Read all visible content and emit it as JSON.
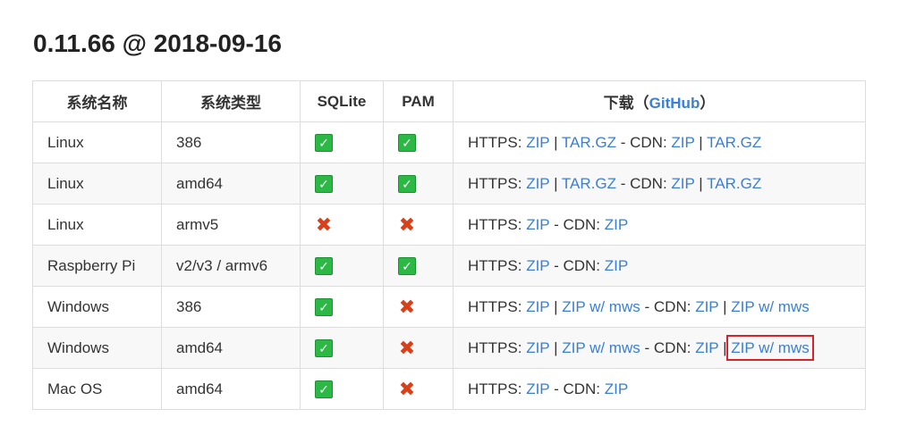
{
  "release": {
    "title": "0.11.66 @ 2018-09-16"
  },
  "table": {
    "headers": {
      "system_name": "系统名称",
      "system_type": "系统类型",
      "sqlite": "SQLite",
      "pam": "PAM",
      "download_prefix": "下载（",
      "github": "GitHub",
      "download_suffix": "）"
    },
    "labels": {
      "https": "HTTPS:",
      "cdn": "CDN:",
      "pipe": "|",
      "dash": "-"
    },
    "rows": [
      {
        "name": "Linux",
        "type": "386",
        "sqlite": "check-icon",
        "pam": "check-icon",
        "https": [
          "ZIP",
          "TAR.GZ"
        ],
        "cdn": [
          "ZIP",
          "TAR.GZ"
        ]
      },
      {
        "name": "Linux",
        "type": "amd64",
        "sqlite": "check-icon",
        "pam": "check-icon",
        "https": [
          "ZIP",
          "TAR.GZ"
        ],
        "cdn": [
          "ZIP",
          "TAR.GZ"
        ]
      },
      {
        "name": "Linux",
        "type": "armv5",
        "sqlite": "cross-icon",
        "pam": "cross-icon",
        "https": [
          "ZIP"
        ],
        "cdn": [
          "ZIP"
        ]
      },
      {
        "name": "Raspberry Pi",
        "type": "v2/v3 / armv6",
        "sqlite": "check-icon",
        "pam": "check-icon",
        "https": [
          "ZIP"
        ],
        "cdn": [
          "ZIP"
        ]
      },
      {
        "name": "Windows",
        "type": "386",
        "sqlite": "check-icon",
        "pam": "cross-icon",
        "https": [
          "ZIP",
          "ZIP w/ mws"
        ],
        "cdn": [
          "ZIP",
          "ZIP w/ mws"
        ]
      },
      {
        "name": "Windows",
        "type": "amd64",
        "sqlite": "check-icon",
        "pam": "cross-icon",
        "https": [
          "ZIP",
          "ZIP w/ mws"
        ],
        "cdn": [
          "ZIP",
          "ZIP w/ mws"
        ]
      },
      {
        "name": "Mac OS",
        "type": "amd64",
        "sqlite": "check-icon",
        "pam": "cross-icon",
        "https": [
          "ZIP"
        ],
        "cdn": [
          "ZIP"
        ]
      }
    ]
  },
  "highlight": {
    "color": "#d8232a"
  },
  "colors": {
    "link": "#3a7fd5",
    "check": "#2bb845",
    "cross": "#d9401a"
  }
}
